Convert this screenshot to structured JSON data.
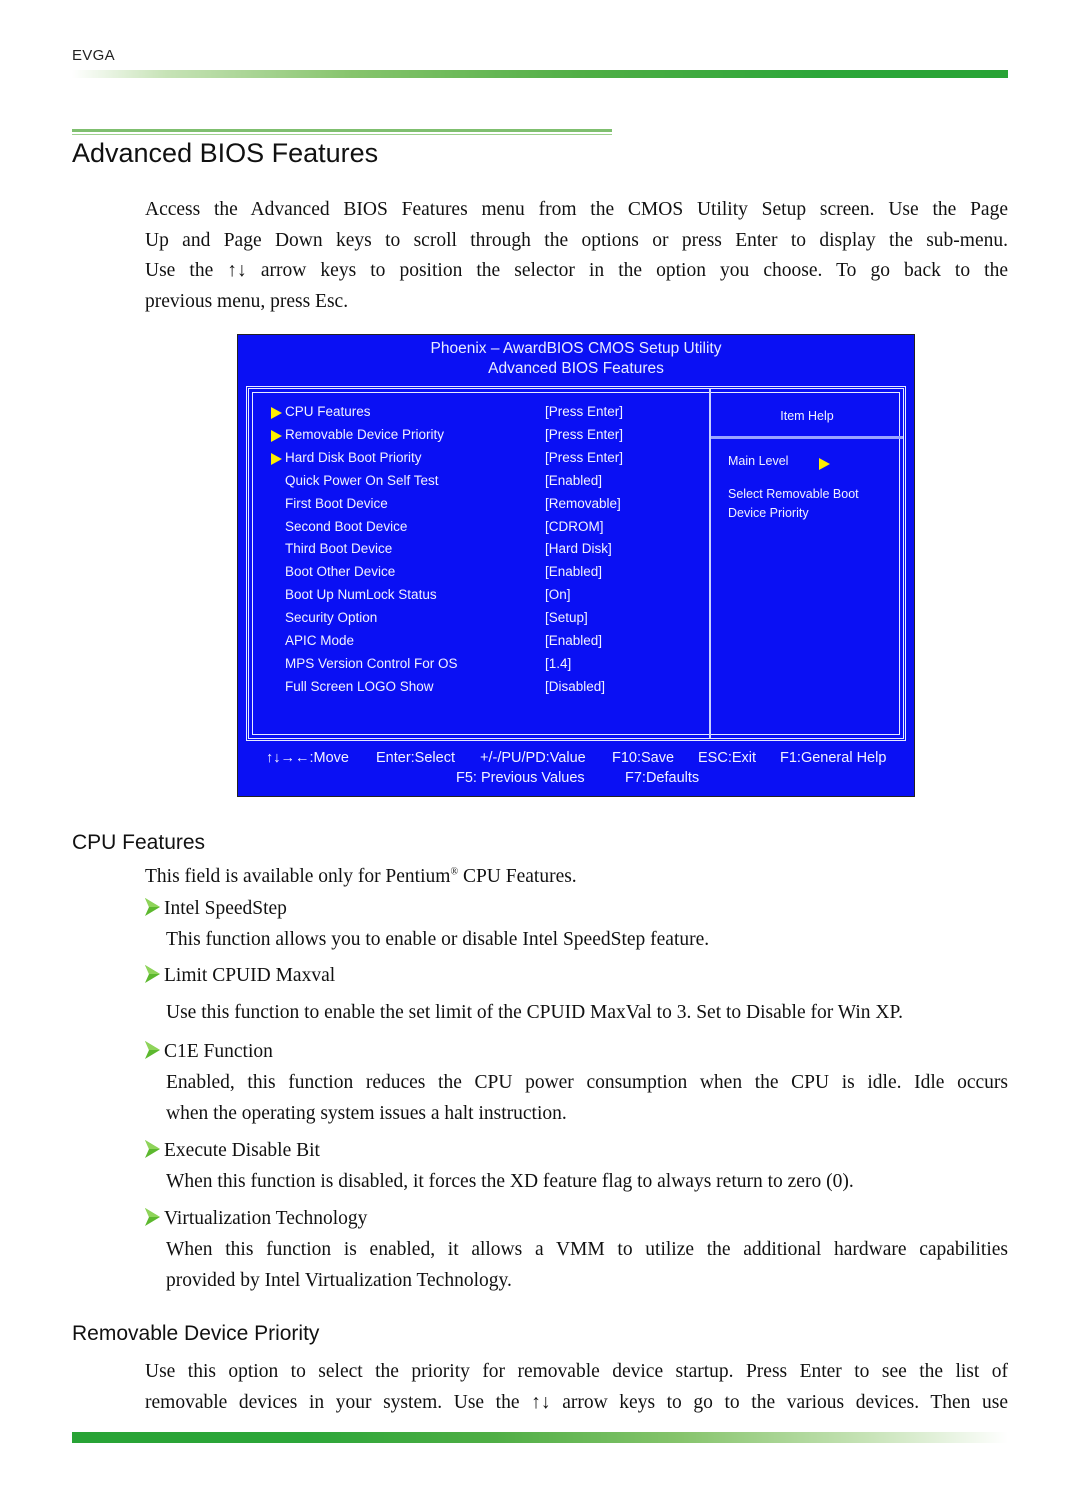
{
  "header": {
    "brand": "EVGA"
  },
  "page": {
    "title": "Advanced BIOS Features",
    "intro": [
      "Access the Advanced BIOS Features menu from the CMOS Utility Setup screen. Use the Page",
      "Up and Page Down keys to scroll through the options or press Enter to display the sub-menu.",
      "Use the ↑↓ arrow keys to position the selector in the option you choose. To go back to the",
      "previous menu, press Esc."
    ]
  },
  "bios": {
    "title_line1": "Phoenix – AwardBIOS CMOS Setup Utility",
    "title_line2": "Advanced BIOS Features",
    "items": [
      {
        "label": "CPU Features",
        "value": "[Press Enter]",
        "submenu": true
      },
      {
        "label": "Removable Device Priority",
        "value": "[Press Enter]",
        "submenu": true
      },
      {
        "label": "Hard Disk Boot Priority",
        "value": "[Press Enter]",
        "submenu": true
      },
      {
        "label": "Quick Power On Self Test",
        "value": "[Enabled]",
        "submenu": false
      },
      {
        "label": "First Boot Device",
        "value": "[Removable]",
        "submenu": false
      },
      {
        "label": "Second Boot Device",
        "value": "[CDROM]",
        "submenu": false
      },
      {
        "label": "Third Boot Device",
        "value": "[Hard Disk]",
        "submenu": false
      },
      {
        "label": "Boot Other Device",
        "value": "[Enabled]",
        "submenu": false
      },
      {
        "label": "Boot Up NumLock Status",
        "value": "[On]",
        "submenu": false
      },
      {
        "label": "Security Option",
        "value": "[Setup]",
        "submenu": false
      },
      {
        "label": "APIC Mode",
        "value": "[Enabled]",
        "submenu": false
      },
      {
        "label": "MPS Version Control For OS",
        "value": "[1.4]",
        "submenu": false
      },
      {
        "label": "Full Screen LOGO Show",
        "value": "[Disabled]",
        "submenu": false
      }
    ],
    "help": {
      "title": "Item Help",
      "main_level": "Main Level",
      "text_line1": "Select Removable Boot",
      "text_line2": "Device Priority"
    },
    "keys_line1": {
      "move": "↑↓→←:Move",
      "select": "Enter:Select",
      "value": "+/-/PU/PD:Value",
      "save": "F10:Save",
      "exit": "ESC:Exit",
      "help": "F1:General Help"
    },
    "keys_line2": {
      "previous": "F5: Previous Values",
      "defaults": "F7:Defaults"
    },
    "colors": {
      "background": "#0a10f4",
      "arrow": "#ffee00",
      "text": "#f2f2ff"
    }
  },
  "cpu_features": {
    "heading": "CPU Features",
    "intro_before": "This field is available only for Pentium",
    "intro_sup": "®",
    "intro_after": " CPU Features.",
    "items": [
      {
        "title": "Intel SpeedStep",
        "desc": [
          "This function allows you to enable or disable Intel SpeedStep feature."
        ]
      },
      {
        "title": "Limit CPUID Maxval",
        "desc": [
          "Use this function to enable the set limit of the CPUID MaxVal to 3. Set to Disable for Win XP."
        ]
      },
      {
        "title": "C1E Function",
        "desc": [
          "Enabled, this function reduces the CPU power consumption when the CPU is idle. Idle occurs",
          "when the operating system issues a halt instruction."
        ]
      },
      {
        "title": "Execute Disable Bit",
        "desc": [
          "When this function is disabled, it forces the XD feature flag to always return to zero (0)."
        ]
      },
      {
        "title": "Virtualization Technology",
        "desc": [
          "When this function is enabled, it allows a VMM to utilize the additional hardware capabilities",
          "provided by Intel Virtualization Technology."
        ]
      }
    ]
  },
  "removable_device_priority": {
    "heading": "Removable Device Priority",
    "text": [
      "Use this option to select the priority for removable device startup. Press Enter to see the list of",
      "removable devices in your system. Use the ↑↓ arrow keys to go to the various devices. Then use"
    ]
  },
  "colors": {
    "accent_green": "#2ca639"
  }
}
